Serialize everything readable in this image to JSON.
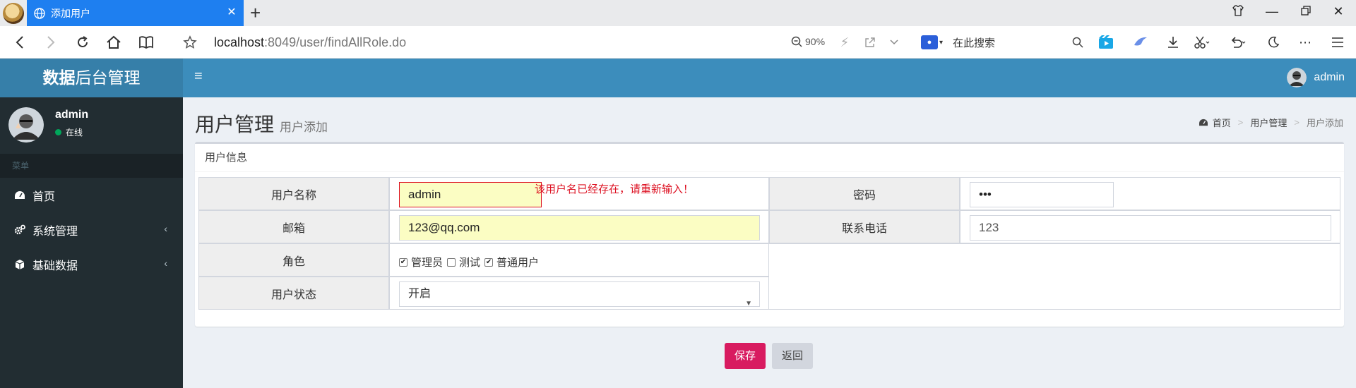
{
  "browser": {
    "tab_title": "添加用户",
    "url_host": "localhost",
    "url_rest": ":8049/user/findAllRole.do",
    "zoom": "90%",
    "search_placeholder": "在此搜索"
  },
  "app": {
    "logo_bold": "数据",
    "logo_rest": "后台管理",
    "header_user": "admin"
  },
  "sidebar": {
    "user_name": "admin",
    "status": "在线",
    "menu_header": "菜单",
    "items": [
      {
        "label": "首页"
      },
      {
        "label": "系统管理"
      },
      {
        "label": "基础数据"
      }
    ]
  },
  "page": {
    "title": "用户管理",
    "subtitle": "用户添加",
    "breadcrumb": [
      "首页",
      "用户管理",
      "用户添加"
    ]
  },
  "form": {
    "box_title": "用户信息",
    "username_label": "用户名称",
    "username_value": "admin",
    "username_error": "该用户名已经存在，请重新输入！",
    "password_label": "密码",
    "password_value": "•••",
    "email_label": "邮箱",
    "email_value": "123@qq.com",
    "phone_label": "联系电话",
    "phone_value": "123",
    "role_label": "角色",
    "roles": [
      {
        "label": "管理员",
        "checked": true
      },
      {
        "label": "测试",
        "checked": false
      },
      {
        "label": "普通用户",
        "checked": true
      }
    ],
    "status_label": "用户状态",
    "status_value": "开启"
  },
  "buttons": {
    "save": "保存",
    "back": "返回"
  }
}
